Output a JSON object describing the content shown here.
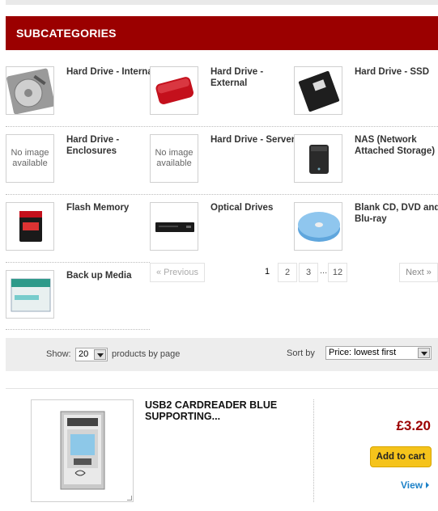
{
  "subcategories": {
    "header": "SUBCATEGORIES",
    "no_image_text": "No image available",
    "items": [
      {
        "name": "Hard Drive - Internal"
      },
      {
        "name": "Hard Drive - External"
      },
      {
        "name": "Hard Drive - SSD"
      },
      {
        "name": "Hard Drive - Enclosures"
      },
      {
        "name": "Hard Drive - Server"
      },
      {
        "name": "NAS (Network Attached Storage)"
      },
      {
        "name": "Flash Memory"
      },
      {
        "name": "Optical Drives"
      },
      {
        "name": "Blank CD, DVD and Blu-ray"
      },
      {
        "name": "Back up Media"
      }
    ]
  },
  "pagination": {
    "previous": "« Previous",
    "pages": [
      "1",
      "2",
      "3",
      "12"
    ],
    "ellipsis": "...",
    "next": "Next »",
    "current": "1"
  },
  "toolbar": {
    "show_label": "Show:",
    "show_value": "20",
    "per_page_label": "products by page",
    "sort_label": "Sort by",
    "sort_value": "Price: lowest first"
  },
  "product": {
    "title": "USB2 CARDREADER BLUE SUPPORTING...",
    "price": "£3.20",
    "add_to_cart": "Add to cart",
    "view": "View"
  }
}
